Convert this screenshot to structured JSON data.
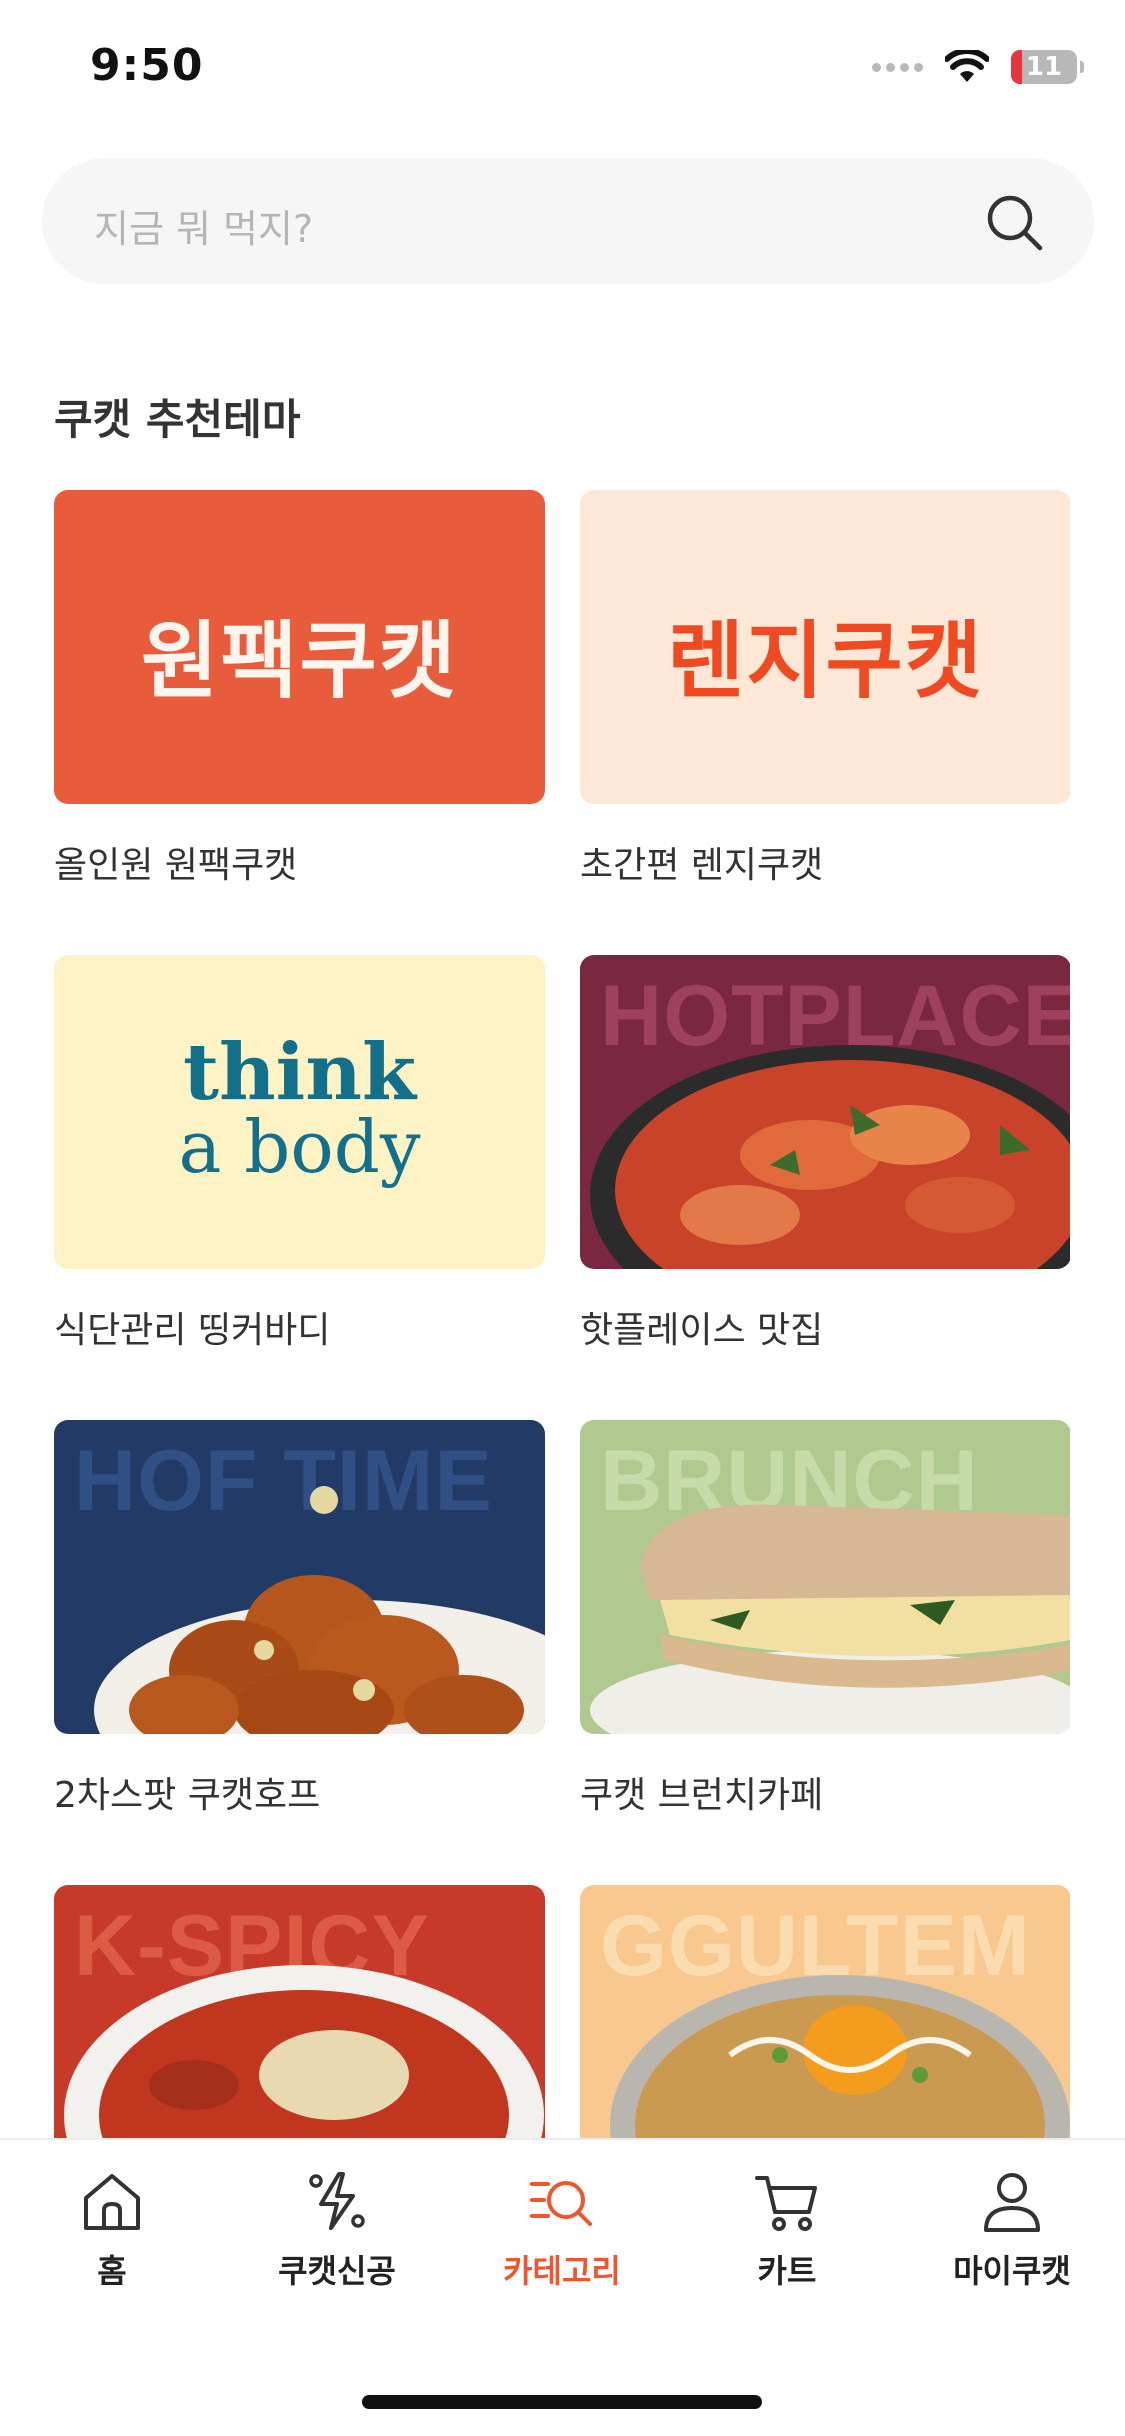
{
  "status_bar": {
    "time": "9:50",
    "battery": "11"
  },
  "search": {
    "placeholder": "지금 뭐 먹지?"
  },
  "section": {
    "title": "쿠캣 추천테마"
  },
  "themes": [
    {
      "label": "올인원 원팩쿠캣",
      "banner_text": "원팩쿠캣",
      "bg": "#e85c3c"
    },
    {
      "label": "초간편 렌지쿠캣",
      "banner_text": "렌지쿠캣",
      "bg": "#fde8d7"
    },
    {
      "label": "식단관리 띵커바디",
      "banner_line1": "think",
      "banner_line2": "a body",
      "bg": "#fdf3c4"
    },
    {
      "label": "핫플레이스 맛집",
      "ghost": "HOTPLACE",
      "bg": "#7a2840"
    },
    {
      "label": "2차스팟 쿠캣호프",
      "ghost": "HOF TIME",
      "bg": "#223a66"
    },
    {
      "label": "쿠캣 브런치카페",
      "ghost": "BRUNCH",
      "bg": "#b0c98e"
    },
    {
      "label": "",
      "ghost": "K-SPICY",
      "bg": "#c73a2a"
    },
    {
      "label": "",
      "ghost": "GGULTEM",
      "bg": "#f8c88e"
    }
  ],
  "tabbar": {
    "tabs": [
      {
        "label": "홈",
        "icon": "home-icon"
      },
      {
        "label": "쿠캣신공",
        "icon": "lightning-icon"
      },
      {
        "label": "카테고리",
        "icon": "category-search-icon"
      },
      {
        "label": "카트",
        "icon": "cart-icon"
      },
      {
        "label": "마이쿠캣",
        "icon": "profile-icon"
      }
    ],
    "active": "카테고리",
    "accent_color": "#f0552e"
  }
}
